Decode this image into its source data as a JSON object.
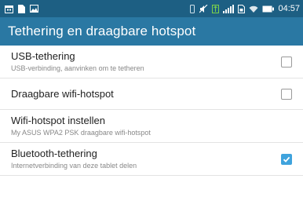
{
  "status_bar": {
    "time": "04:57",
    "left_icons": [
      "calendar-icon",
      "document-icon",
      "image-icon"
    ],
    "right_icons": [
      "vibrate-icon",
      "mute-icon",
      "data-icon",
      "signal-icon",
      "sim-icon",
      "wifi-icon",
      "battery-icon"
    ]
  },
  "app_bar": {
    "title": "Tethering en draagbare hotspot"
  },
  "settings": [
    {
      "title": "USB-tethering",
      "subtitle": "USB-verbinding, aanvinken om te tetheren",
      "checkbox": true,
      "checked": false
    },
    {
      "title": "Draagbare wifi-hotspot",
      "subtitle": "",
      "checkbox": true,
      "checked": false
    },
    {
      "title": "Wifi-hotspot instellen",
      "subtitle": "My ASUS WPA2 PSK draagbare wifi-hotspot",
      "checkbox": false
    },
    {
      "title": "Bluetooth-tethering",
      "subtitle": "Internetverbinding van deze tablet delen",
      "checkbox": true,
      "checked": true
    }
  ],
  "colors": {
    "status_bar": "#1d5f83",
    "app_bar": "#2a78a3",
    "checkbox_checked": "#3fa3dd",
    "status_green": "#7cd34a"
  }
}
